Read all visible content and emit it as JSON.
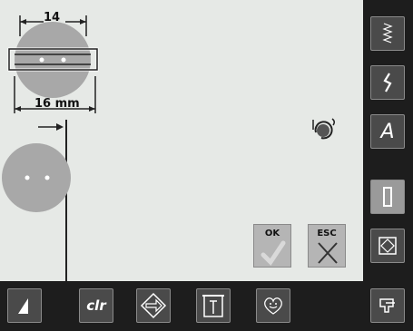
{
  "canvas": {
    "top_dimension": "14",
    "bottom_dimension": "16 mm",
    "ok_label": "OK",
    "esc_label": "ESC"
  },
  "colors": {
    "button_circle": "#a8a8a8",
    "canvas_bg": "#e6e9e6",
    "bar_bg": "#1d1d1d"
  },
  "right_toolbar": [
    {
      "icon": "zigzag-stitch-icon"
    },
    {
      "icon": "decorative-stitch-icon"
    },
    {
      "icon": "alphabet-icon",
      "glyph": "A"
    },
    {
      "icon": "buttonhole-icon"
    },
    {
      "icon": "quilt-icon"
    },
    {
      "icon": "presser-foot-icon"
    }
  ],
  "bottom_toolbar": [
    {
      "icon": "ramp-icon"
    },
    {
      "icon": "clr-icon",
      "label": "clr"
    },
    {
      "icon": "rotate-arrow-icon"
    },
    {
      "icon": "tab-page-icon"
    },
    {
      "icon": "smiley-icon"
    }
  ]
}
